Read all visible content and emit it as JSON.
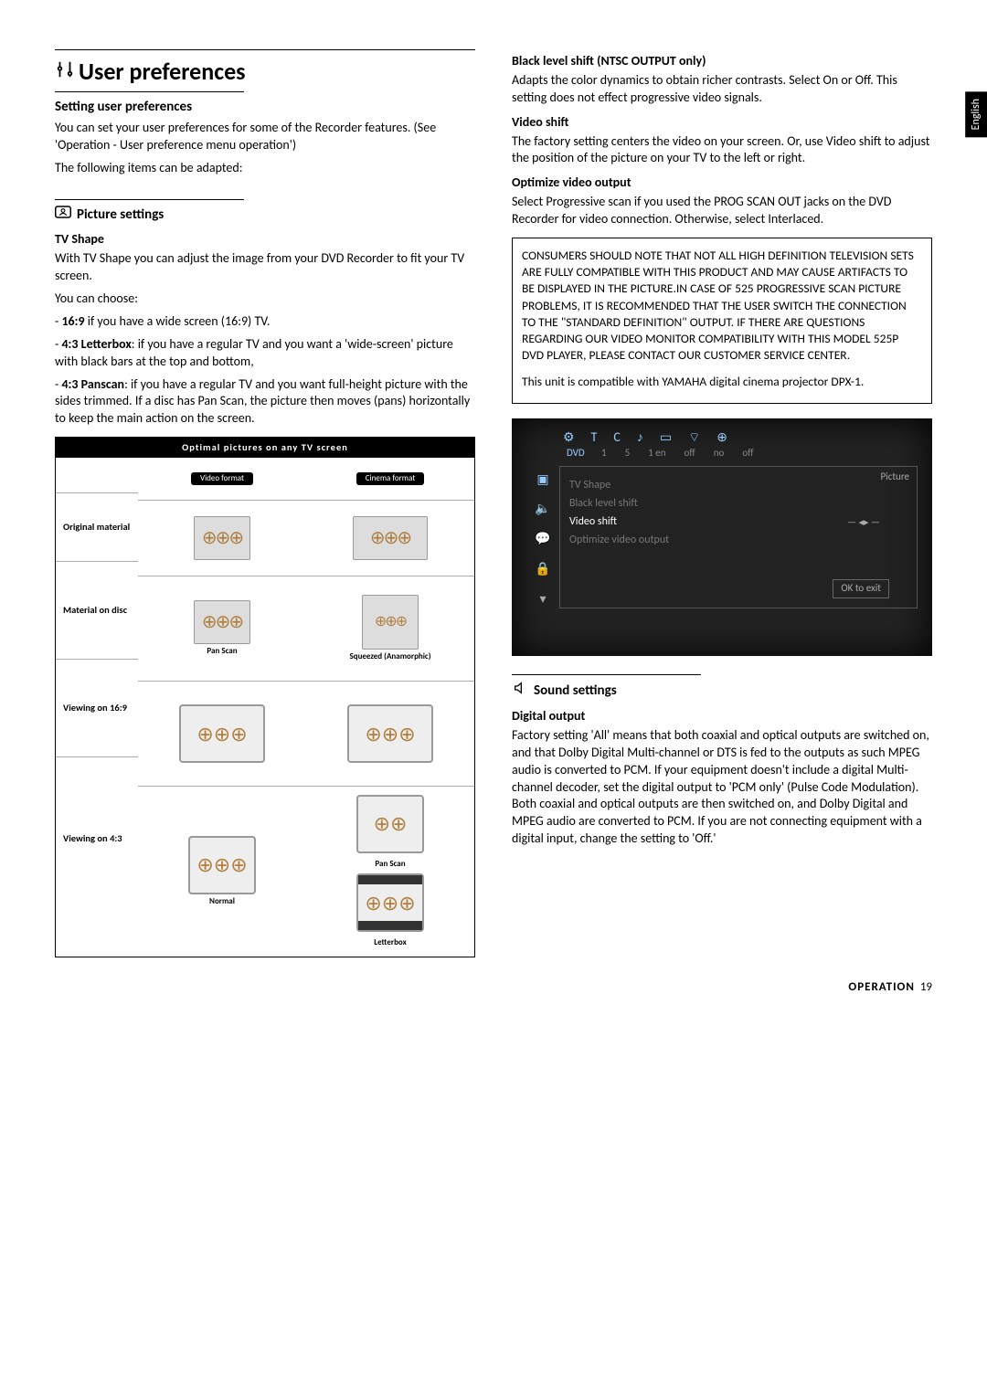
{
  "sideTab": "English",
  "header": {
    "title": "User preferences",
    "icon": "preferences-icon"
  },
  "section1": {
    "title": "Setting user preferences",
    "p1": "You can set your user preferences for some of the Recorder features. (See 'Operation - User preference menu operation')",
    "p2": "The following items can be adapted:"
  },
  "picture": {
    "title": "Picture settings",
    "tvShapeHead": "TV Shape",
    "tvShape1": "With TV Shape you can adjust the image from your DVD Recorder to fit your TV screen.",
    "tvShape2": "You can choose:",
    "opt1a": "- ",
    "opt1b": "16:9",
    "opt1c": " if you have a wide screen (16:9) TV.",
    "opt2a": "- ",
    "opt2b": "4:3 Letterbox",
    "opt2c": ": if you have a regular TV and you want a 'wide-screen' picture with black bars at the top and bottom,",
    "opt3a": "- ",
    "opt3b": "4:3 Panscan",
    "opt3c": ": if you have a regular TV and you want full-height picture with the sides trimmed. If a disc has Pan Scan, the picture then moves (pans) horizontally to keep the main action on the screen."
  },
  "figure": {
    "title": "Optimal pictures on any TV screen",
    "videoFormat": "Video format",
    "cinemaFormat": "Cinema format",
    "rowOriginal": "Original material",
    "rowDisc": "Material on disc",
    "captionPanScan": "Pan Scan",
    "captionSqueezed": "Squeezed (Anamorphic)",
    "row169": "Viewing on 16:9",
    "row43": "Viewing on 4:3",
    "captionNormal": "Normal",
    "captionPanScan2": "Pan Scan",
    "captionLetterbox": "Letterbox"
  },
  "right": {
    "blsHead": "Black level shift (NTSC OUTPUT only)",
    "bls": "Adapts the color dynamics to obtain richer contrasts. Select On or Off. This setting does not effect progressive video signals.",
    "vsHead": "Video shift",
    "vs": "The factory setting centers the video on your screen. Or, use Video shift to adjust the position of the picture on your TV to the left or right.",
    "ovoHead": "Optimize video output",
    "ovo": "Select Progressive scan if you used the PROG SCAN OUT jacks on the DVD Recorder for video connection. Otherwise, select Interlaced.",
    "notice": "CONSUMERS SHOULD NOTE THAT NOT ALL HIGH DEFINITION TELEVISION SETS ARE FULLY COMPATIBLE WITH THIS PRODUCT AND MAY CAUSE ARTIFACTS TO BE DISPLAYED IN THE PICTURE.IN CASE OF 525 PROGRESSIVE SCAN PICTURE PROBLEMS, IT IS RECOMMENDED THAT THE USER SWITCH THE CONNECTION TO THE \"STANDARD DEFINITION\" OUTPUT. IF THERE ARE QUESTIONS REGARDING OUR VIDEO MONITOR COMPATIBILITY WITH THIS MODEL 525P DVD PLAYER, PLEASE CONTACT OUR CUSTOMER SERVICE CENTER.",
    "yamaha": "This unit is compatible with YAMAHA digital cinema projector DPX-1."
  },
  "osd": {
    "dvd": "DVD",
    "vals": [
      "1",
      "5",
      "1 en",
      "off",
      "no",
      "off"
    ],
    "tag": "Picture",
    "items": [
      "TV Shape",
      "Black level shift",
      "Video shift",
      "Optimize video output"
    ],
    "selectedIndex": 2,
    "arrow": "— ◂▸ —",
    "ok": "OK to exit"
  },
  "sound": {
    "title": "Sound settings",
    "doHead": "Digital output",
    "do": "Factory setting 'All' means that both coaxial and optical outputs are switched on, and that Dolby Digital Multi-channel or DTS is fed to the outputs as such MPEG audio is converted to PCM. If your equipment doesn't include a digital Multi-channel decoder, set the digital output to 'PCM only' (Pulse Code Modulation). Both coaxial and optical outputs are then switched on, and Dolby Digital and MPEG audio are converted to PCM. If you are not connecting equipment with a digital input, change the setting to 'Off.'"
  },
  "footer": {
    "label": "OPERATION",
    "page": "19"
  }
}
